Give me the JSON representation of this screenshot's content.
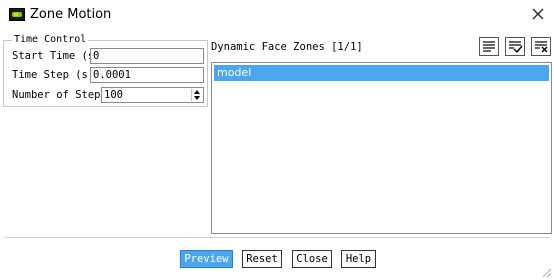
{
  "window": {
    "title": "Zone Motion",
    "icon": "fluent-app-icon",
    "close_icon": "close-icon"
  },
  "time_control": {
    "group_label": "Time Control",
    "start_time": {
      "label": "Start Time (s)",
      "value": "0"
    },
    "time_step": {
      "label": "Time Step (s)",
      "value": "0.0001"
    },
    "num_steps": {
      "label": "Number of Steps",
      "value": "100"
    }
  },
  "dynamic_face_zones": {
    "label": "Dynamic Face Zones [1/1]",
    "items": [
      {
        "label": "model",
        "selected": true
      }
    ],
    "toolbar": [
      "select-all-icon",
      "filter-select-icon",
      "deselect-all-icon"
    ]
  },
  "buttons": {
    "preview": "Preview",
    "reset": "Reset",
    "close": "Close",
    "help": "Help"
  },
  "colors": {
    "selection": "#4ca6ef",
    "primary_button": "#4ca6ef"
  }
}
